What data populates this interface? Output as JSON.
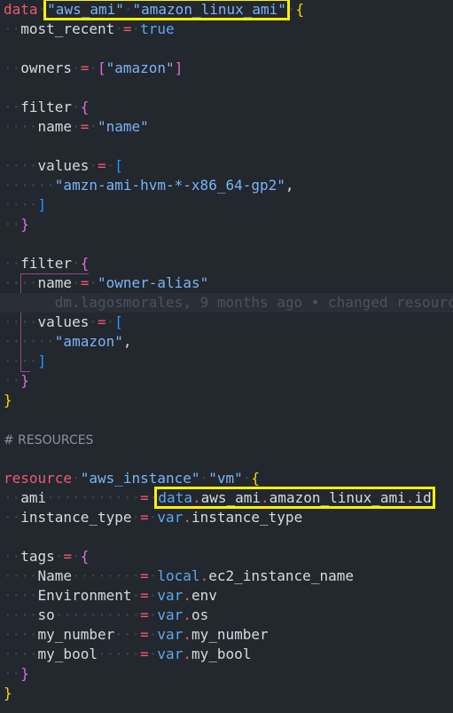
{
  "colors": {
    "background": "#23272e",
    "highlight_box": "#fff200",
    "keyword": "#ef596f",
    "string": "#7ab4f5"
  },
  "blame": "dm.lagosmorales, 9 months ago • changed resourc",
  "lines": [
    [
      [
        "kw",
        "data "
      ],
      [
        "str",
        "\"aws_ami\"",
        "hl"
      ],
      [
        "ws",
        " ",
        "hl"
      ],
      [
        "str",
        "\"amazon_linux_ami\"",
        "hl"
      ],
      [
        "ws",
        " "
      ],
      [
        "b1",
        "{"
      ]
    ],
    [
      [
        "ws",
        "  "
      ],
      [
        "id",
        "most_recent "
      ],
      [
        "op",
        "= "
      ],
      [
        "bool",
        "true"
      ]
    ],
    [],
    [
      [
        "ws",
        "  "
      ],
      [
        "id",
        "owners "
      ],
      [
        "op",
        "= "
      ],
      [
        "b2",
        "["
      ],
      [
        "str",
        "\"amazon\""
      ],
      [
        "b2",
        "]"
      ]
    ],
    [],
    [
      [
        "ws",
        "  "
      ],
      [
        "id",
        "filter "
      ],
      [
        "b2",
        "{"
      ]
    ],
    [
      [
        "ws",
        "    "
      ],
      [
        "id",
        "name "
      ],
      [
        "op",
        "= "
      ],
      [
        "str",
        "\"name\""
      ]
    ],
    [],
    [
      [
        "ws",
        "    "
      ],
      [
        "id",
        "values "
      ],
      [
        "op",
        "= "
      ],
      [
        "b3",
        "["
      ]
    ],
    [
      [
        "ws",
        "      "
      ],
      [
        "str",
        "\"amzn-ami-hvm-*-x86_64-gp2\""
      ],
      [
        "id",
        ","
      ]
    ],
    [
      [
        "ws",
        "    "
      ],
      [
        "b3",
        "]"
      ]
    ],
    [
      [
        "ws",
        "  "
      ],
      [
        "b2",
        "}"
      ]
    ],
    [],
    [
      [
        "ws",
        "  "
      ],
      [
        "id",
        "filter "
      ],
      [
        "b2",
        "{"
      ]
    ],
    [
      [
        "ws",
        "    "
      ],
      [
        "id",
        "name "
      ],
      [
        "op",
        "= "
      ],
      [
        "str",
        "\"owner-alias\""
      ]
    ],
    [
      [
        "blame",
        "      "
      ]
    ],
    [
      [
        "ws",
        "    "
      ],
      [
        "id",
        "values "
      ],
      [
        "op",
        "= "
      ],
      [
        "b3",
        "["
      ]
    ],
    [
      [
        "ws",
        "      "
      ],
      [
        "str",
        "\"amazon\""
      ],
      [
        "id",
        ","
      ]
    ],
    [
      [
        "ws",
        "    "
      ],
      [
        "b3",
        "]"
      ]
    ],
    [
      [
        "ws",
        "  "
      ],
      [
        "b2",
        "}"
      ]
    ],
    [
      [
        "b1",
        "}"
      ]
    ],
    [],
    [
      [
        "comment",
        "# RESOURCES"
      ]
    ],
    [],
    [
      [
        "kw",
        "resource "
      ],
      [
        "str",
        "\"aws_instance\""
      ],
      [
        "ws",
        " "
      ],
      [
        "str",
        "\"vm\""
      ],
      [
        "ws",
        " "
      ],
      [
        "b1",
        "{"
      ]
    ],
    [
      [
        "ws",
        "  "
      ],
      [
        "id",
        "ami           "
      ],
      [
        "op",
        "= "
      ],
      [
        "obj",
        "data",
        "hl"
      ],
      [
        "dot",
        ".",
        "hl"
      ],
      [
        "id",
        "aws_ami",
        "hl"
      ],
      [
        "dot",
        ".",
        "hl"
      ],
      [
        "id",
        "amazon_linux_ami",
        "hl"
      ],
      [
        "dot",
        ".",
        "hl"
      ],
      [
        "id",
        "id",
        "hl"
      ]
    ],
    [
      [
        "ws",
        "  "
      ],
      [
        "id",
        "instance_type "
      ],
      [
        "op",
        "= "
      ],
      [
        "obj",
        "var"
      ],
      [
        "dot",
        "."
      ],
      [
        "id",
        "instance_type"
      ]
    ],
    [],
    [
      [
        "ws",
        "  "
      ],
      [
        "id",
        "tags "
      ],
      [
        "op",
        "= "
      ],
      [
        "b2",
        "{"
      ]
    ],
    [
      [
        "ws",
        "    "
      ],
      [
        "id",
        "Name        "
      ],
      [
        "op",
        "= "
      ],
      [
        "obj",
        "local"
      ],
      [
        "dot",
        "."
      ],
      [
        "id",
        "ec2_instance_name"
      ]
    ],
    [
      [
        "ws",
        "    "
      ],
      [
        "id",
        "Environment "
      ],
      [
        "op",
        "= "
      ],
      [
        "obj",
        "var"
      ],
      [
        "dot",
        "."
      ],
      [
        "id",
        "env"
      ]
    ],
    [
      [
        "ws",
        "    "
      ],
      [
        "id",
        "so          "
      ],
      [
        "op",
        "= "
      ],
      [
        "obj",
        "var"
      ],
      [
        "dot",
        "."
      ],
      [
        "id",
        "os"
      ]
    ],
    [
      [
        "ws",
        "    "
      ],
      [
        "id",
        "my_number   "
      ],
      [
        "op",
        "= "
      ],
      [
        "obj",
        "var"
      ],
      [
        "dot",
        "."
      ],
      [
        "id",
        "my_number"
      ]
    ],
    [
      [
        "ws",
        "    "
      ],
      [
        "id",
        "my_bool     "
      ],
      [
        "op",
        "= "
      ],
      [
        "obj",
        "var"
      ],
      [
        "dot",
        "."
      ],
      [
        "id",
        "my_bool"
      ]
    ],
    [
      [
        "ws",
        "  "
      ],
      [
        "b2",
        "}"
      ]
    ],
    [
      [
        "b1",
        "}"
      ]
    ]
  ]
}
